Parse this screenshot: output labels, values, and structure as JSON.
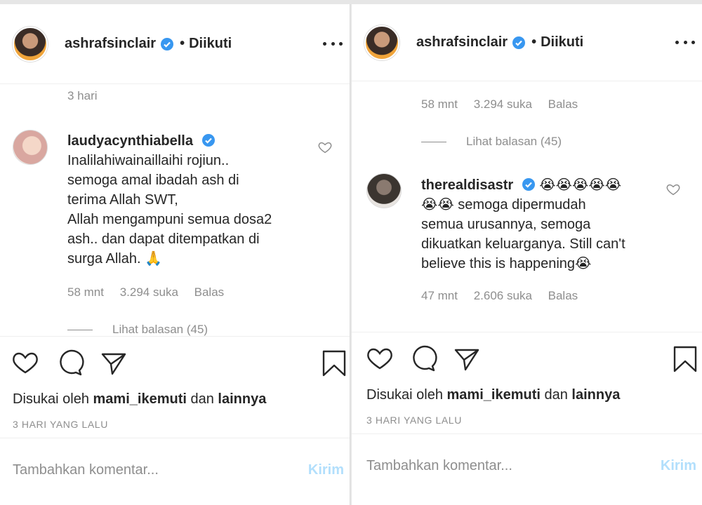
{
  "left": {
    "header": {
      "username": "ashrafsinclair",
      "dot": "•",
      "follow_status": "Diikuti"
    },
    "prev_time": "3 hari",
    "comment": {
      "username": "laudyacynthiabella",
      "lines": [
        "Inalilahiwainaillaihi rojiun..",
        "semoga amal ibadah ash di",
        "terima Allah SWT,",
        "Allah mengampuni semua dosa2",
        "ash.. dan dapat ditempatkan di",
        "surga Allah. 🙏"
      ],
      "time": "58 mnt",
      "likes": "3.294 suka",
      "reply": "Balas",
      "view_replies": "Lihat balasan (45)"
    },
    "liked_by": {
      "prefix": "Disukai oleh",
      "user": "mami_ikemuti",
      "mid": "dan",
      "others": "lainnya"
    },
    "time_ago": "3 HARI YANG LALU",
    "add_comment": {
      "placeholder": "Tambahkan komentar...",
      "post": "Kirim"
    }
  },
  "right": {
    "header": {
      "username": "ashrafsinclair",
      "dot": "•",
      "follow_status": "Diikuti"
    },
    "prev_meta": {
      "time": "58 mnt",
      "likes": "3.294 suka",
      "reply": "Balas"
    },
    "prev_view_replies": "Lihat balasan (45)",
    "comment": {
      "username": "therealdisastr",
      "emoji_inline": "😭😭😭😭😭",
      "lines_rest_first": "😭😭 semoga dipermudah",
      "lines": [
        "semua urusannya, semoga",
        "dikuatkan keluarganya. Still can't",
        "believe this is happening😭"
      ],
      "time": "47 mnt",
      "likes": "2.606 suka",
      "reply": "Balas"
    },
    "liked_by": {
      "prefix": "Disukai oleh",
      "user": "mami_ikemuti",
      "mid": "dan",
      "others": "lainnya"
    },
    "time_ago": "3 HARI YANG LALU",
    "add_comment": {
      "placeholder": "Tambahkan komentar...",
      "post": "Kirim"
    }
  },
  "colors": {
    "verified": "#3897f0",
    "post_disabled": "#b2dffc",
    "muted": "#8e8e8e"
  }
}
